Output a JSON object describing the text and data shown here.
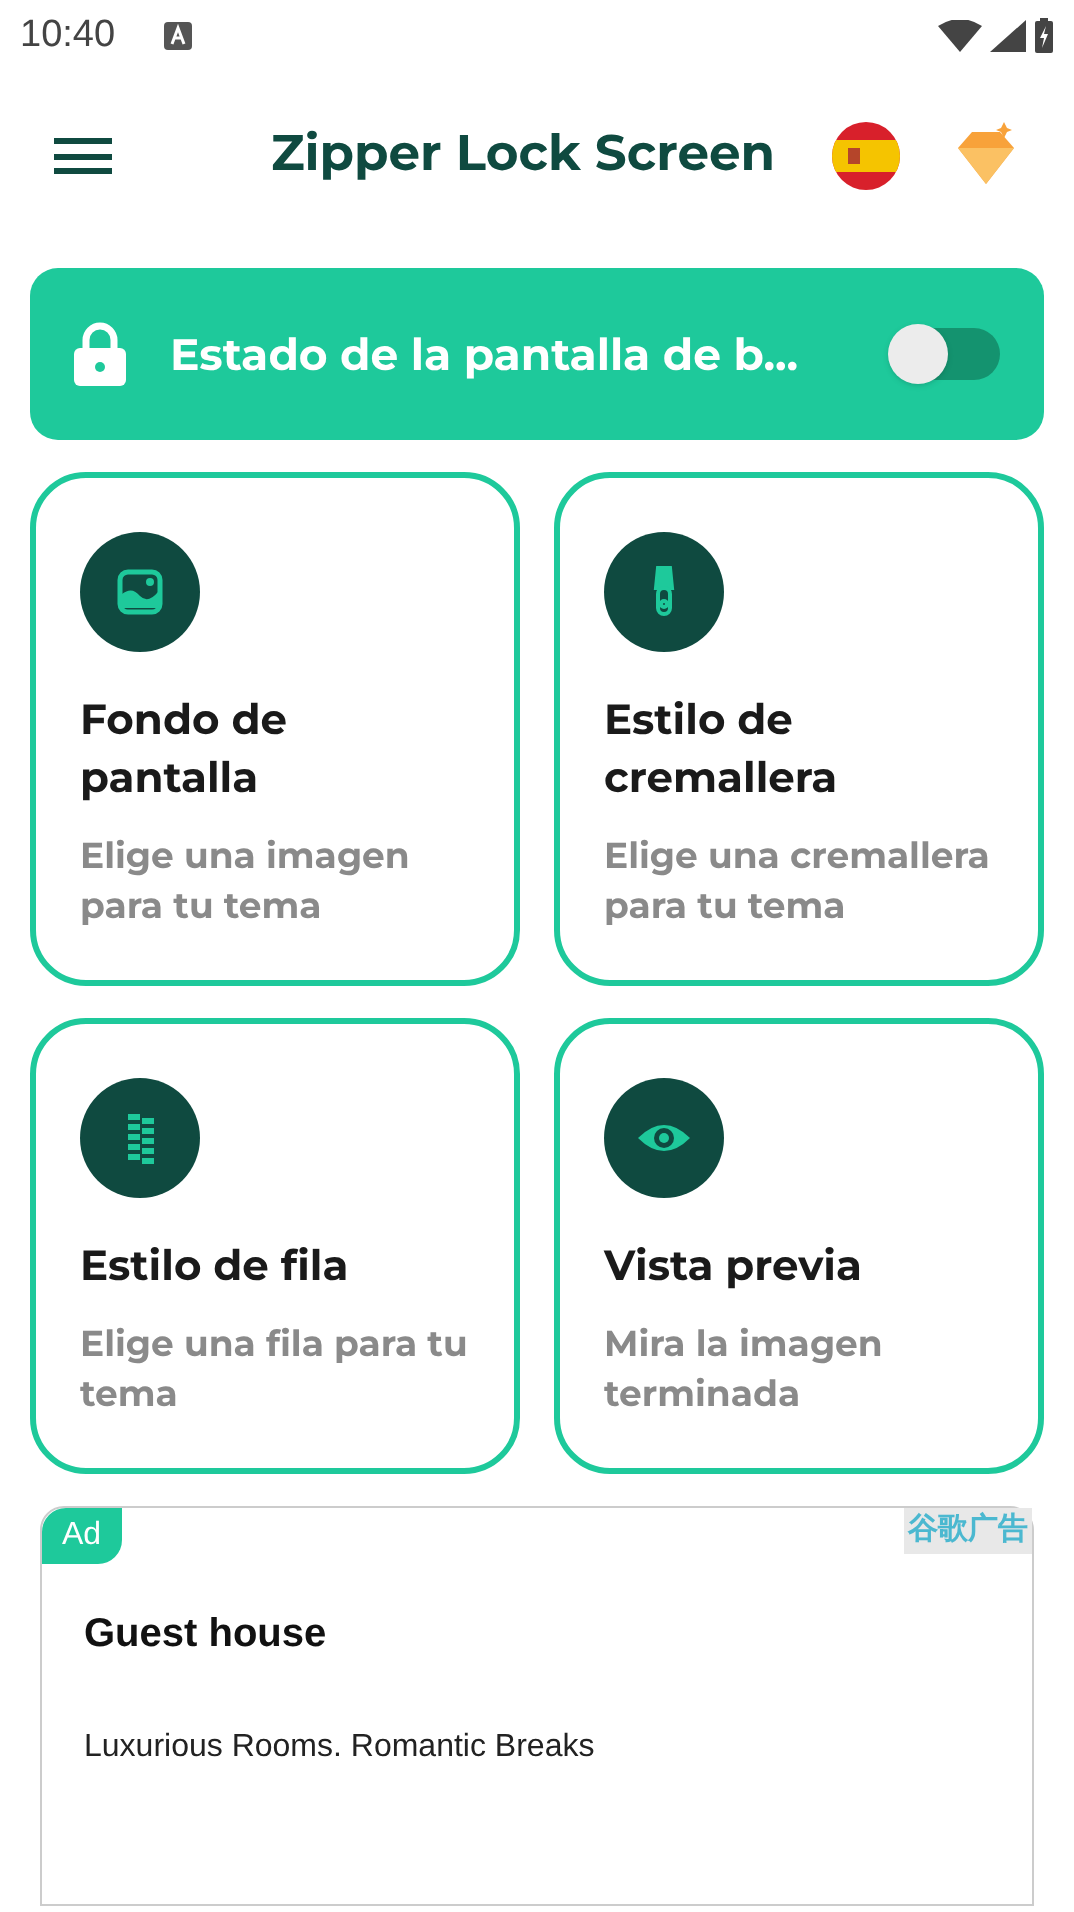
{
  "status_bar": {
    "time": "10:40"
  },
  "app_bar": {
    "title": "Zipper Lock Screen"
  },
  "lock_banner": {
    "label": "Estado de la pantalla de b...",
    "on": false
  },
  "cards": [
    {
      "kind": "wallpaper",
      "title": "Fondo de pantalla",
      "description": "Elige una imagen para tu tema"
    },
    {
      "kind": "zipper",
      "title": "Estilo de cremallera",
      "description": "Elige una cremallera para tu tema"
    },
    {
      "kind": "row",
      "title": "Estilo de fila",
      "description": "Elige una fila para tu tema"
    },
    {
      "kind": "preview",
      "title": "Vista previa",
      "description": "Mira la imagen terminada"
    }
  ],
  "ad": {
    "badge": "Ad",
    "network_label": "谷歌广告",
    "title": "Guest house",
    "text": "Luxurious Rooms. Romantic Breaks"
  }
}
